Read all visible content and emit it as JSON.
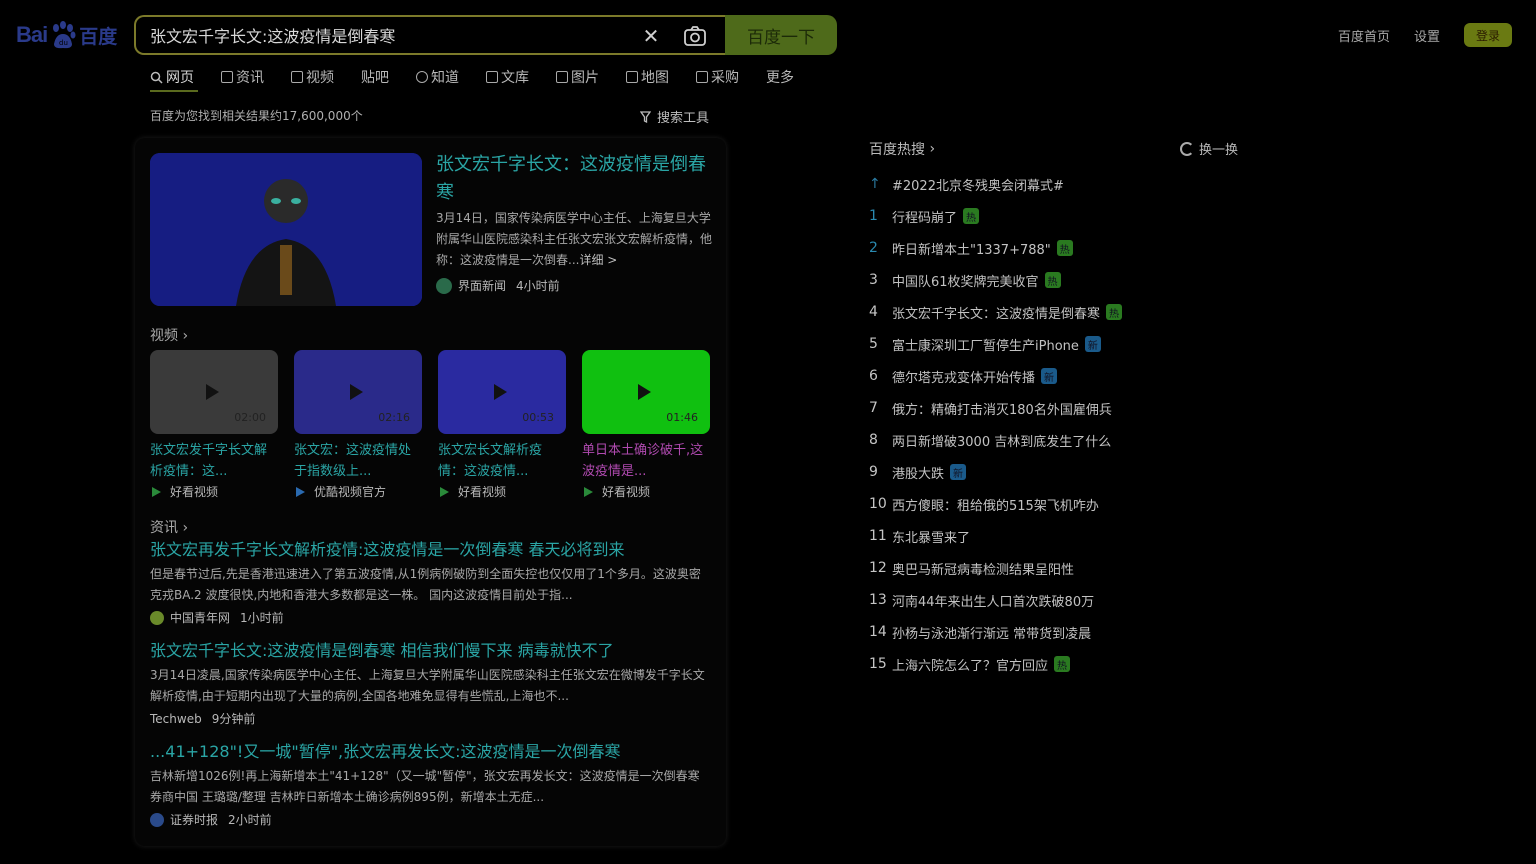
{
  "logo": {
    "left": "Bai",
    "right": "百度"
  },
  "search": {
    "query": "张文宏千字长文:这波疫情是倒春寒",
    "button": "百度一下"
  },
  "topnav": {
    "home": "百度首页",
    "settings": "设置",
    "login": "登录"
  },
  "tabs": [
    "网页",
    "资讯",
    "视频",
    "贴吧",
    "知道",
    "文库",
    "图片",
    "地图",
    "采购",
    "更多"
  ],
  "result_count": "百度为您找到相关结果约17,600,000个",
  "search_tools": "搜索工具",
  "featured": {
    "title": "张文宏千字长文：这波疫情是倒春寒",
    "desc": "3月14日，国家传染病医学中心主任、上海复旦大学附属华山医院感染科主任张文宏张文宏解析疫情，他称：这波疫情是一次倒春...",
    "more": "详细 >",
    "source": "界面新闻",
    "time": "4小时前"
  },
  "videos_label": "视频",
  "videos": [
    {
      "title": "张文宏发千字长文解析疫情：这...",
      "duration": "02:00",
      "source": "好看视频",
      "bg": "#3a3a3a"
    },
    {
      "title": "张文宏：这波疫情处于指数级上...",
      "duration": "02:16",
      "source": "优酷视频官方",
      "bg": "#2a2a8a"
    },
    {
      "title": "张文宏长文解析疫情：这波疫情...",
      "duration": "00:53",
      "source": "好看视频",
      "bg": "#2a2aa0"
    },
    {
      "title": "单日本土确诊破千,这波疫情是...",
      "duration": "01:46",
      "source": "好看视频",
      "bg": "#10c010"
    }
  ],
  "news_label": "资讯",
  "news": [
    {
      "title": "张文宏再发千字长文解析疫情:这波疫情是一次倒春寒 春天必将到来",
      "desc": "但是春节过后,先是香港迅速进入了第五波疫情,从1例病例破防到全面失控也仅仅用了1个多月。这波奥密克戎BA.2 波度很快,内地和香港大多数都是这一株。 国内这波疫情目前处于指...",
      "source": "中国青年网",
      "time": "1小时前"
    },
    {
      "title": "张文宏千字长文:这波疫情是倒春寒 相信我们慢下来 病毒就快不了",
      "desc": "3月14日凌晨,国家传染病医学中心主任、上海复旦大学附属华山医院感染科主任张文宏在微博发千字长文解析疫情,由于短期内出现了大量的病例,全国各地难免显得有些慌乱,上海也不...",
      "source": "Techweb",
      "time": "9分钟前"
    },
    {
      "title": "...41+128\"!又一城\"暂停\",张文宏再发长文:这波疫情是一次倒春寒",
      "desc": "吉林新增1026例!再上海新增本土\"41+128\"（又一城\"暂停\"，张文宏再发长文：这波疫情是一次倒春寒 券商中国 王璐璐/整理 吉林昨日新增本土确诊病例895例，新增本土无症...",
      "source": "证券时报",
      "time": "2小时前"
    }
  ],
  "hot": {
    "title": "百度热搜",
    "refresh": "换一换",
    "items": [
      {
        "rank": "↑",
        "text": "#2022北京冬残奥会闭幕式#",
        "badge": ""
      },
      {
        "rank": "1",
        "text": "行程码崩了",
        "badge": "热"
      },
      {
        "rank": "2",
        "text": "昨日新增本土\"1337+788\"",
        "badge": "热"
      },
      {
        "rank": "3",
        "text": "中国队61枚奖牌完美收官",
        "badge": "热"
      },
      {
        "rank": "4",
        "text": "张文宏千字长文：这波疫情是倒春寒",
        "badge": "热"
      },
      {
        "rank": "5",
        "text": "富士康深圳工厂暂停生产iPhone",
        "badge": "新"
      },
      {
        "rank": "6",
        "text": "德尔塔克戎变体开始传播",
        "badge": "新"
      },
      {
        "rank": "7",
        "text": "俄方：精确打击消灭180名外国雇佣兵",
        "badge": ""
      },
      {
        "rank": "8",
        "text": "两日新增破3000 吉林到底发生了什么",
        "badge": ""
      },
      {
        "rank": "9",
        "text": "港股大跌",
        "badge": "新"
      },
      {
        "rank": "10",
        "text": "西方傻眼：租给俄的515架飞机咋办",
        "badge": ""
      },
      {
        "rank": "11",
        "text": "东北暴雪来了",
        "badge": ""
      },
      {
        "rank": "12",
        "text": "奥巴马新冠病毒检测结果呈阳性",
        "badge": ""
      },
      {
        "rank": "13",
        "text": "河南44年来出生人口首次跌破80万",
        "badge": ""
      },
      {
        "rank": "14",
        "text": "孙杨与泳池渐行渐远 常带货到凌晨",
        "badge": ""
      },
      {
        "rank": "15",
        "text": "上海六院怎么了？官方回应",
        "badge": "热"
      }
    ]
  }
}
